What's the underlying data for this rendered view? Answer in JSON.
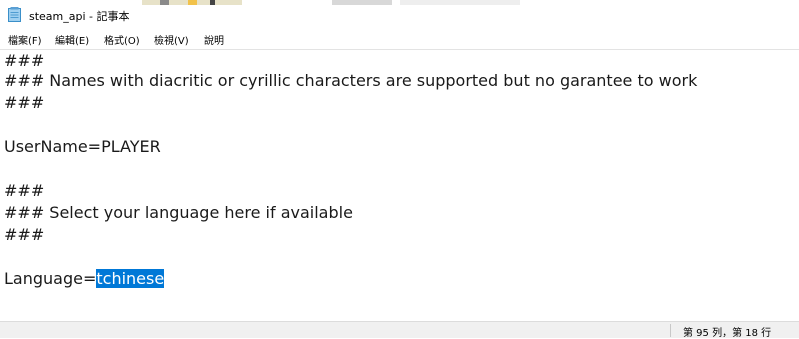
{
  "window": {
    "title": "steam_api - 記事本",
    "icon": "notepad-icon"
  },
  "menu": {
    "items": [
      "檔案(F)",
      "編輯(E)",
      "格式(O)",
      "檢視(V)",
      "說明"
    ]
  },
  "editor": {
    "lines": [
      "###",
      "### Names with diacritic or cyrillic characters are supported but no garantee to work",
      "###",
      "",
      "UserName=PLAYER",
      "",
      "###",
      "### Select your language here if available",
      "###",
      "",
      "Language="
    ],
    "selected_text": "tchinese",
    "selection_color": "#0078d7"
  },
  "status": {
    "position": "第 95 列，第 18 行"
  }
}
